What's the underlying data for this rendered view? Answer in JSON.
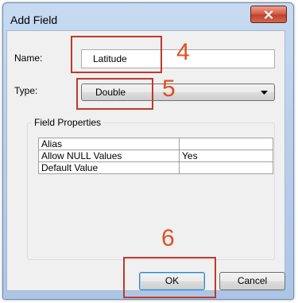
{
  "window": {
    "title": "Add Field",
    "close_icon": "close-icon"
  },
  "form": {
    "name_label": "Name:",
    "name_value": "Latitude",
    "type_label": "Type:",
    "type_value": "Double",
    "dropdown_icon": "chevron-down-icon"
  },
  "field_properties": {
    "legend": "Field Properties",
    "rows": [
      {
        "key": "Alias",
        "value": ""
      },
      {
        "key": "Allow NULL Values",
        "value": "Yes"
      },
      {
        "key": "Default Value",
        "value": ""
      }
    ]
  },
  "buttons": {
    "ok_label": "OK",
    "cancel_label": "Cancel"
  },
  "annotations": {
    "step_name": "4",
    "step_type": "5",
    "step_ok": "6",
    "highlight_color": "#c0392b",
    "number_color": "#e05022"
  }
}
